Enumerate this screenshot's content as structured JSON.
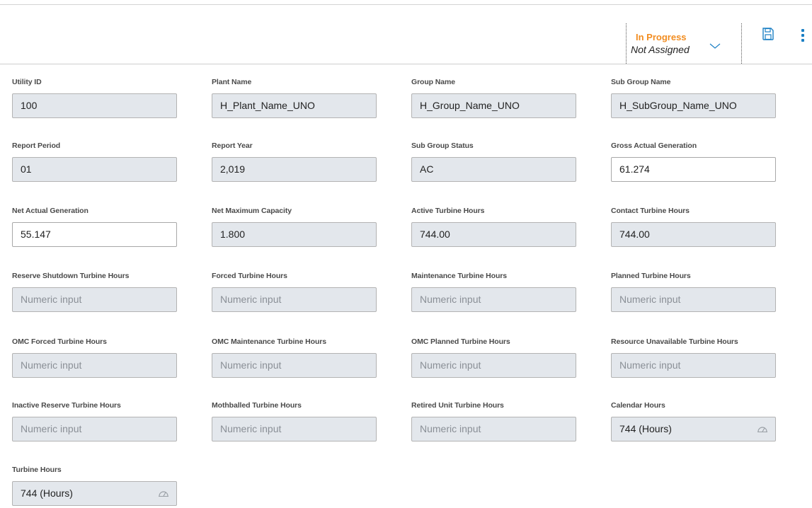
{
  "header": {
    "status": "In Progress",
    "assignment": "Not Assigned",
    "save_icon": "save-icon",
    "more_icon": "more-vertical-icon",
    "status_color": "#f28d21",
    "accent_color": "#1a7fc4"
  },
  "fields": [
    {
      "label": "Utility ID",
      "value": "100",
      "editable": false,
      "placeholder": false
    },
    {
      "label": "Plant Name",
      "value": "H_Plant_Name_UNO",
      "editable": false,
      "placeholder": false
    },
    {
      "label": "Group Name",
      "value": "H_Group_Name_UNO",
      "editable": false,
      "placeholder": false
    },
    {
      "label": "Sub Group Name",
      "value": "H_SubGroup_Name_UNO",
      "editable": false,
      "placeholder": false
    },
    {
      "label": "Report Period",
      "value": "01",
      "editable": false,
      "placeholder": false
    },
    {
      "label": "Report Year",
      "value": "2,019",
      "editable": false,
      "placeholder": false
    },
    {
      "label": "Sub Group Status",
      "value": "AC",
      "editable": false,
      "placeholder": false
    },
    {
      "label": "Gross Actual Generation",
      "value": "61.274",
      "editable": true,
      "placeholder": false
    },
    {
      "label": "Net Actual Generation",
      "value": "55.147",
      "editable": true,
      "placeholder": false
    },
    {
      "label": "Net Maximum Capacity",
      "value": "1.800",
      "editable": false,
      "placeholder": false
    },
    {
      "label": "Active Turbine Hours",
      "value": "744.00",
      "editable": false,
      "placeholder": false
    },
    {
      "label": "Contact Turbine Hours",
      "value": "744.00",
      "editable": false,
      "placeholder": false
    },
    {
      "label": "Reserve Shutdown Turbine Hours",
      "value": "Numeric input",
      "editable": false,
      "placeholder": true
    },
    {
      "label": "Forced Turbine Hours",
      "value": "Numeric input",
      "editable": false,
      "placeholder": true
    },
    {
      "label": "Maintenance Turbine Hours",
      "value": "Numeric input",
      "editable": false,
      "placeholder": true
    },
    {
      "label": "Planned Turbine Hours",
      "value": "Numeric input",
      "editable": false,
      "placeholder": true
    },
    {
      "label": "OMC Forced Turbine Hours",
      "value": "Numeric input",
      "editable": false,
      "placeholder": true
    },
    {
      "label": "OMC Maintenance Turbine Hours",
      "value": "Numeric input",
      "editable": false,
      "placeholder": true
    },
    {
      "label": "OMC Planned Turbine Hours",
      "value": "Numeric input",
      "editable": false,
      "placeholder": true
    },
    {
      "label": "Resource Unavailable Turbine Hours",
      "value": "Numeric input",
      "editable": false,
      "placeholder": true
    },
    {
      "label": "Inactive Reserve Turbine Hours",
      "value": "Numeric input",
      "editable": false,
      "placeholder": true
    },
    {
      "label": "Mothballed Turbine Hours",
      "value": "Numeric input",
      "editable": false,
      "placeholder": true
    },
    {
      "label": "Retired Unit Turbine Hours",
      "value": "Numeric input",
      "editable": false,
      "placeholder": true
    },
    {
      "label": "Calendar Hours",
      "value": "744 (Hours)",
      "editable": false,
      "placeholder": false,
      "icon": "calculator-icon"
    },
    {
      "label": "Turbine Hours",
      "value": "744 (Hours)",
      "editable": false,
      "placeholder": false,
      "icon": "calculator-icon"
    }
  ]
}
